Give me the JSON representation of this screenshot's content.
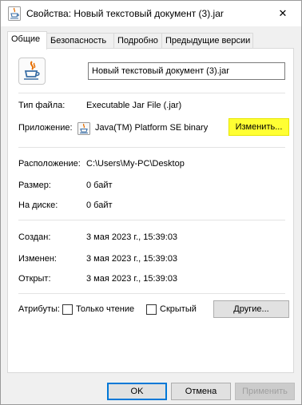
{
  "window": {
    "title": "Свойства: Новый текстовый документ (3).jar",
    "close_symbol": "✕"
  },
  "tabs": [
    {
      "label": "Общие"
    },
    {
      "label": "Безопасность"
    },
    {
      "label": "Подробно"
    },
    {
      "label": "Предыдущие версии"
    }
  ],
  "general": {
    "file_name": "Новый текстовый документ (3).jar",
    "file_type_label": "Тип файла:",
    "file_type_value": "Executable Jar File (.jar)",
    "app_label": "Приложение:",
    "app_value": "Java(TM) Platform SE binary",
    "change_button": "Изменить...",
    "location_label": "Расположение:",
    "location_value": "C:\\Users\\My-PC\\Desktop",
    "size_label": "Размер:",
    "size_value": "0 байт",
    "disk_label": "На диске:",
    "disk_value": "0 байт",
    "created_label": "Создан:",
    "created_value": "3 мая 2023 г., 15:39:03",
    "modified_label": "Изменен:",
    "modified_value": "3 мая 2023 г., 15:39:03",
    "opened_label": "Открыт:",
    "opened_value": "3 мая 2023 г., 15:39:03",
    "attributes_label": "Атрибуты:",
    "readonly_label": "Только чтение",
    "hidden_label": "Скрытый",
    "other_button": "Другие..."
  },
  "footer": {
    "ok_button": "OK",
    "cancel_button": "Отмена",
    "apply_button": "Применить"
  },
  "colors": {
    "highlight": "#ffff33",
    "accent": "#0078d7"
  }
}
